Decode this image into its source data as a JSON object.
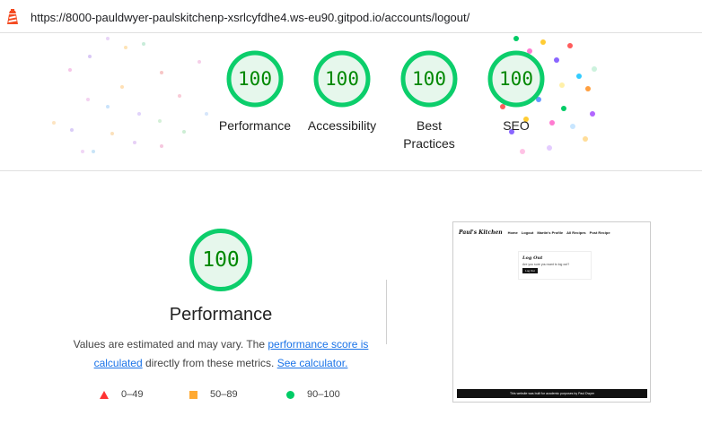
{
  "browser": {
    "url": "https://8000-pauldwyer-paulskitchenp-xsrlcyfdhe4.ws-eu90.gitpod.io/accounts/logout/",
    "icon": "lighthouse-icon"
  },
  "summary_scores": [
    {
      "score": "100",
      "label": "Performance"
    },
    {
      "score": "100",
      "label": "Accessibility"
    },
    {
      "score": "100",
      "label": "Best Practices"
    },
    {
      "score": "100",
      "label": "SEO"
    }
  ],
  "performance": {
    "score": "100",
    "title": "Performance",
    "desc_prefix": "Values are estimated and may vary. The ",
    "link_score": "performance score is calculated",
    "desc_mid": " directly from these metrics. ",
    "link_calc": "See calculator."
  },
  "legend": [
    {
      "range": "0–49",
      "color": "#ff3333"
    },
    {
      "range": "50–89",
      "color": "#ffaa33"
    },
    {
      "range": "90–100",
      "color": "#00cc66"
    }
  ],
  "screenshot": {
    "brand": "Paul's Kitchen",
    "nav_items": [
      "Home",
      "Logout",
      "Martin's Profile",
      "All Recipes",
      "Post Recipe"
    ],
    "card_title": "Log Out",
    "card_message": "Are you sure you want to log out?",
    "card_button": "Log Out",
    "footer": "This website was built for academic purposes by Paul Dwyer"
  },
  "colors": {
    "pass_green": "#0cce6b",
    "pass_fill": "#e6f7ec",
    "pass_text": "#008800",
    "link": "#1a73e8"
  }
}
